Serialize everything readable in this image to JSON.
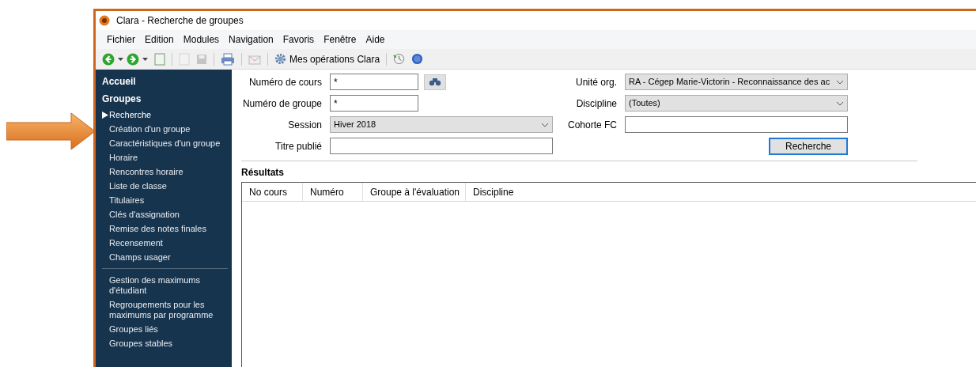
{
  "window": {
    "title": "Clara - Recherche de groupes"
  },
  "menu": [
    "Fichier",
    "Edition",
    "Modules",
    "Navigation",
    "Favoris",
    "Fenêtre",
    "Aide"
  ],
  "toolbar": {
    "operations_label": "Mes opérations Clara"
  },
  "sidebar": {
    "headings": [
      "Accueil",
      "Groupes"
    ],
    "groups": [
      [
        {
          "label": "Recherche",
          "selected": true
        },
        {
          "label": "Création d'un groupe",
          "selected": false
        },
        {
          "label": "Caractéristiques d'un groupe",
          "selected": false
        },
        {
          "label": "Horaire",
          "selected": false
        },
        {
          "label": "Rencontres horaire",
          "selected": false
        },
        {
          "label": "Liste de classe",
          "selected": false
        },
        {
          "label": "Titulaires",
          "selected": false
        },
        {
          "label": "Clés d'assignation",
          "selected": false
        },
        {
          "label": "Remise des notes finales",
          "selected": false
        },
        {
          "label": "Recensement",
          "selected": false
        },
        {
          "label": "Champs usager",
          "selected": false
        }
      ],
      [
        {
          "label": "Gestion des maximums d'étudiant",
          "selected": false
        },
        {
          "label": "Regroupements pour les maximums par programme",
          "selected": false
        },
        {
          "label": "Groupes liés",
          "selected": false
        },
        {
          "label": "Groupes stables",
          "selected": false
        }
      ]
    ]
  },
  "form": {
    "left": [
      {
        "label": "Numéro de cours",
        "kind": "text",
        "value": "*",
        "lookup": true
      },
      {
        "label": "Numéro de groupe",
        "kind": "text",
        "value": "*",
        "lookup": false
      },
      {
        "label": "Session",
        "kind": "select",
        "value": "Hiver 2018",
        "lookup": false
      },
      {
        "label": "Titre publié",
        "kind": "text",
        "lookup": false
      }
    ],
    "right": [
      {
        "label": "Unité org.",
        "kind": "select",
        "value": "RA - Cégep Marie-Victorin - Reconnaissance des ac"
      },
      {
        "label": "Discipline",
        "kind": "select",
        "value": "(Toutes)"
      },
      {
        "label": "Cohorte FC",
        "kind": "text"
      }
    ],
    "search_button": "Recherche"
  },
  "results": {
    "title": "Résultats",
    "columns": [
      "No cours",
      "Numéro",
      "Groupe à l'évaluation",
      "Discipline"
    ]
  }
}
